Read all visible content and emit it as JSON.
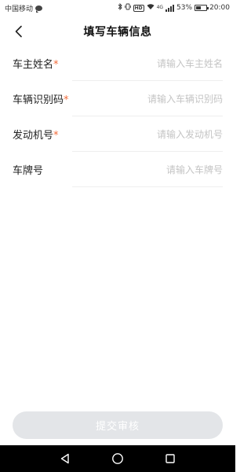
{
  "status_bar": {
    "carrier": "中国移动",
    "battery": "53%",
    "battery_level": 0.53,
    "time": "20:00",
    "hd_badge": "HD",
    "network": "4G"
  },
  "header": {
    "title": "填写车辆信息",
    "back_icon": "chevron-left-icon"
  },
  "form": {
    "fields": [
      {
        "label": "车主姓名",
        "required": true,
        "required_mark": "*",
        "placeholder": "请输入车主姓名",
        "value": ""
      },
      {
        "label": "车辆识别码",
        "required": true,
        "required_mark": "*",
        "placeholder": "请输入车辆识别码",
        "value": ""
      },
      {
        "label": "发动机号",
        "required": true,
        "required_mark": "*",
        "placeholder": "请输入发动机号",
        "value": ""
      },
      {
        "label": "车牌号",
        "required": false,
        "required_mark": "",
        "placeholder": "请输入车牌号",
        "value": ""
      }
    ]
  },
  "submit": {
    "label": "提交审核",
    "enabled": false
  },
  "system_nav": {
    "back_icon": "triangle-back-icon",
    "home_icon": "circle-home-icon",
    "recents_icon": "square-recents-icon"
  },
  "colors": {
    "required": "#f26b3a",
    "placeholder": "#c4c4c4",
    "button_disabled": "#e3e5e8",
    "divider": "#eeeeee"
  }
}
